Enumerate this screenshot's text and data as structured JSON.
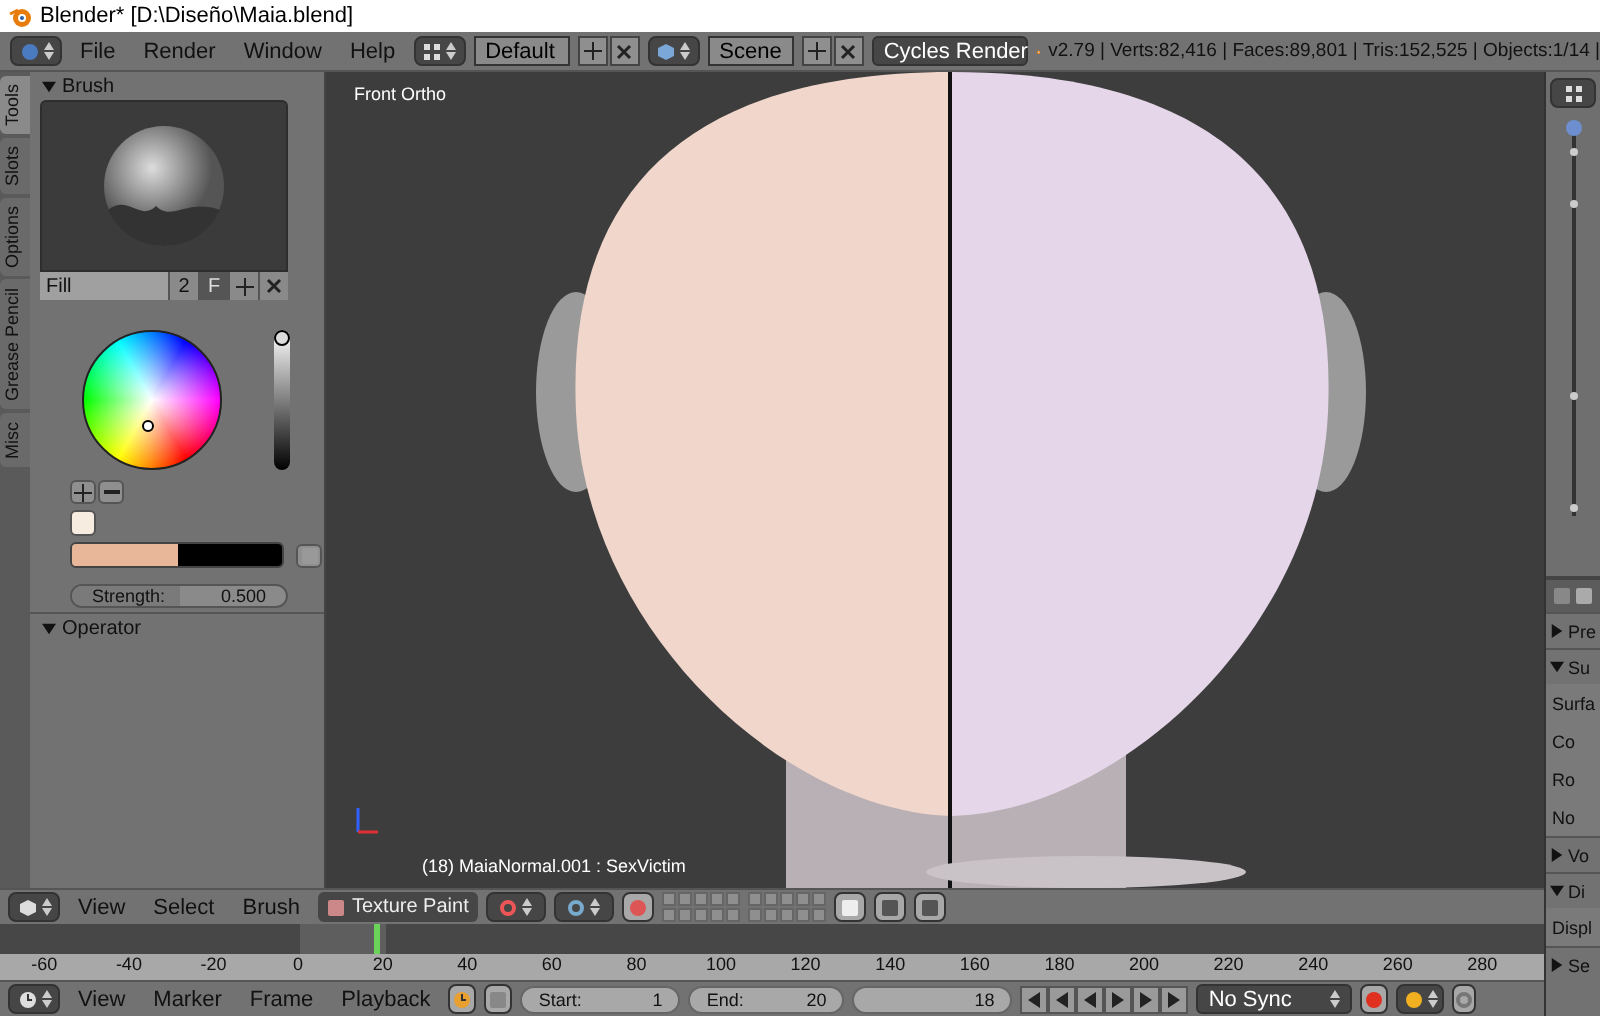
{
  "window": {
    "title": "Blender* [D:\\Diseño\\Maia.blend]"
  },
  "header": {
    "menus": [
      "File",
      "Render",
      "Window",
      "Help"
    ],
    "layout": "Default",
    "scene": "Scene",
    "engine": "Cycles Render",
    "stats": "v2.79 | Verts:82,416 | Faces:89,801 | Tris:152,525 | Objects:1/14 |"
  },
  "tool_tabs": [
    {
      "label": "Tools",
      "selected": true
    },
    {
      "label": "Slots",
      "selected": false
    },
    {
      "label": "Options",
      "selected": false
    },
    {
      "label": "Grease Pencil",
      "selected": false
    },
    {
      "label": "Misc",
      "selected": false
    }
  ],
  "brush_panel": {
    "title": "Brush",
    "expanded": true,
    "brush_name": "Fill",
    "users": "2",
    "fake_user": "F",
    "value_slider": {
      "level": 1
    },
    "colors": [
      {
        "color": "#e8b79a"
      },
      {
        "color": "#000000"
      }
    ],
    "strength": {
      "label": "Strength:",
      "value": "0.500",
      "level": 0.5
    }
  },
  "operator_panel": {
    "title": "Operator",
    "expanded": true
  },
  "viewport": {
    "view_label": "Front Ortho",
    "object_label": "(18) MaiaNormal.001 : SexVictim"
  },
  "view3d_header": {
    "menus": [
      "View",
      "Select",
      "Brush"
    ],
    "mode": "Texture Paint"
  },
  "timeline": {
    "ticks": [
      "-60",
      "-40",
      "-20",
      "0",
      "20",
      "40",
      "60",
      "80",
      "100",
      "120",
      "140",
      "160",
      "180",
      "200",
      "220",
      "240",
      "260",
      "280"
    ],
    "playhead": {
      "level": 0.242
    }
  },
  "timeline_header": {
    "menus": [
      "View",
      "Marker",
      "Frame",
      "Playback"
    ],
    "start": {
      "label": "Start:",
      "value": "1"
    },
    "end": {
      "label": "End:",
      "value": "20"
    },
    "current_frame": "18",
    "sync": "No Sync"
  },
  "properties": {
    "panels": [
      {
        "title": "Pre",
        "expanded": false
      },
      {
        "title": "Su",
        "expanded": true,
        "rows": [
          {
            "label": "Surfa"
          },
          {
            "label": "Co"
          },
          {
            "label": "Ro"
          },
          {
            "label": "No"
          }
        ]
      },
      {
        "title": "Vo",
        "expanded": false
      },
      {
        "title": "Di",
        "expanded": true,
        "rows": [
          {
            "label": "Displ"
          }
        ]
      },
      {
        "title": "Se",
        "expanded": false
      }
    ]
  }
}
